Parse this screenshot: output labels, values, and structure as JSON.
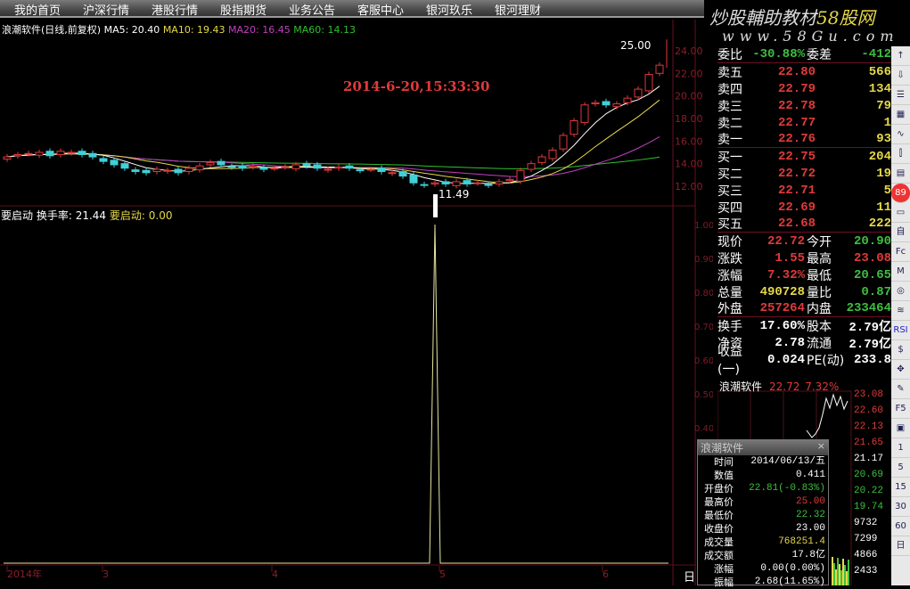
{
  "menu": [
    "我的首页",
    "沪深行情",
    "港股行情",
    "股指期货",
    "业务公告",
    "客服中心",
    "银河玖乐",
    "银河理财"
  ],
  "watermark": {
    "line1": "炒股輔助教材",
    "line1b": "58股网",
    "line2": "www.58Gu.com"
  },
  "title": {
    "name": "浪潮软件(日线,前复权)",
    "ma5": "MA5: 20.40",
    "ma10": "MA10: 19.43",
    "ma20": "MA20: 16.45",
    "ma60": "MA60: 14.13"
  },
  "annotation": "2014-6-20,15:33:30",
  "high_mark": "25.00",
  "low_mark": "11.49",
  "price_axis": [
    "24.00",
    "22.00",
    "20.00",
    "18.00",
    "16.00",
    "14.00",
    "12.00"
  ],
  "indicator": {
    "name": "要启动",
    "label1": "换手率: 21.44",
    "label2": "要启动: 0.00",
    "axis": [
      "1.00",
      "0.90",
      "0.80",
      "0.70",
      "0.60",
      "0.50",
      "0.40"
    ]
  },
  "x_axis": [
    "2014年",
    "3",
    "4",
    "5",
    "6"
  ],
  "period_label": "日",
  "chart_data": {
    "type": "candlestick",
    "closes": [
      14.6,
      14.8,
      14.9,
      15.0,
      14.7,
      15.1,
      15.0,
      14.8,
      14.6,
      14.2,
      13.9,
      13.6,
      13.3,
      13.2,
      13.5,
      13.4,
      13.2,
      13.6,
      13.8,
      14.1,
      13.9,
      13.7,
      13.6,
      13.8,
      13.5,
      13.6,
      13.7,
      13.9,
      13.8,
      13.6,
      13.5,
      13.7,
      13.6,
      13.4,
      13.5,
      13.3,
      13.2,
      12.9,
      12.3,
      12.1,
      12.3,
      12.2,
      12.4,
      12.2,
      12.3,
      12.1,
      12.4,
      12.6,
      13.4,
      14.0,
      14.6,
      15.2,
      16.5,
      17.8,
      19.2,
      19.4,
      19.2,
      19.3,
      19.8,
      20.6,
      21.9,
      22.72
    ],
    "ylim": [
      11,
      25
    ],
    "indicator_spike_index": 40,
    "indicator_ylim": [
      0,
      1
    ]
  },
  "orderbook": {
    "ratio": {
      "k": "委比",
      "v": "-30.88%",
      "k2": "委差",
      "v2": "-412"
    },
    "sell": [
      {
        "k": "卖五",
        "p": "22.80",
        "v": "566"
      },
      {
        "k": "卖四",
        "p": "22.79",
        "v": "134"
      },
      {
        "k": "卖三",
        "p": "22.78",
        "v": "79"
      },
      {
        "k": "卖二",
        "p": "22.77",
        "v": "1"
      },
      {
        "k": "卖一",
        "p": "22.76",
        "v": "93"
      }
    ],
    "buy": [
      {
        "k": "买一",
        "p": "22.75",
        "v": "204"
      },
      {
        "k": "买二",
        "p": "22.72",
        "v": "19"
      },
      {
        "k": "买三",
        "p": "22.71",
        "v": "5"
      },
      {
        "k": "买四",
        "p": "22.69",
        "v": "11"
      },
      {
        "k": "买五",
        "p": "22.68",
        "v": "222"
      }
    ]
  },
  "quote": [
    {
      "k": "现价",
      "v": "22.72",
      "k2": "今开",
      "v2": "20.90"
    },
    {
      "k": "涨跌",
      "v": "1.55",
      "k2": "最高",
      "v2": "23.08"
    },
    {
      "k": "涨幅",
      "v": "7.32%",
      "k2": "最低",
      "v2": "20.65"
    },
    {
      "k": "总量",
      "v": "490728",
      "k2": "量比",
      "v2": "0.87"
    },
    {
      "k": "外盘",
      "v": "257264",
      "k2": "内盘",
      "v2": "233464"
    },
    {
      "k": "换手",
      "v": "17.60%",
      "k2": "股本",
      "v2": "2.79亿"
    },
    {
      "k": "净资",
      "v": "2.78",
      "k2": "流通",
      "v2": "2.79亿"
    },
    {
      "k": "收益(一)",
      "v": "0.024",
      "k2": "PE(动)",
      "v2": "233.8"
    }
  ],
  "mini": {
    "name": "浪潮软件",
    "price": "22.72",
    "pct": "7.32%",
    "axis": [
      "23.08",
      "22.60",
      "22.13",
      "21.65",
      "21.17",
      "20.69",
      "20.22",
      "19.74",
      "9732",
      "7299",
      "4866",
      "2433"
    ]
  },
  "popup": {
    "title": "浪潮软件",
    "close": "×",
    "rows": [
      {
        "k": "时间",
        "v": "2014/06/13/五"
      },
      {
        "k": "数值",
        "v": "0.411"
      },
      {
        "k": "开盘价",
        "v": "22.81(-0.83%)"
      },
      {
        "k": "最高价",
        "v": "25.00"
      },
      {
        "k": "最低价",
        "v": "22.32"
      },
      {
        "k": "收盘价",
        "v": "23.00"
      },
      {
        "k": "成交量",
        "v": "768251.4"
      },
      {
        "k": "成交额",
        "v": "17.8亿"
      },
      {
        "k": "涨幅",
        "v": "0.00(0.00%)"
      },
      {
        "k": "振幅",
        "v": "2.68(11.65%)"
      }
    ]
  },
  "toolbar": [
    "↑",
    "⇩",
    "☰",
    "▦",
    "∿",
    "⫿",
    "▤",
    "89",
    "▭",
    "自",
    "Fc",
    "M",
    "◎",
    "≋",
    "RSI",
    "$",
    "✥",
    "✎",
    "F5",
    "▣",
    "1",
    "5",
    "15",
    "30",
    "60",
    "日"
  ],
  "colors": {
    "up": "#e03a3a",
    "down": "#3fd0d8",
    "ma5": "#ffffff",
    "ma10": "#e6d84a",
    "ma20": "#c040c0",
    "ma60": "#30c030"
  }
}
